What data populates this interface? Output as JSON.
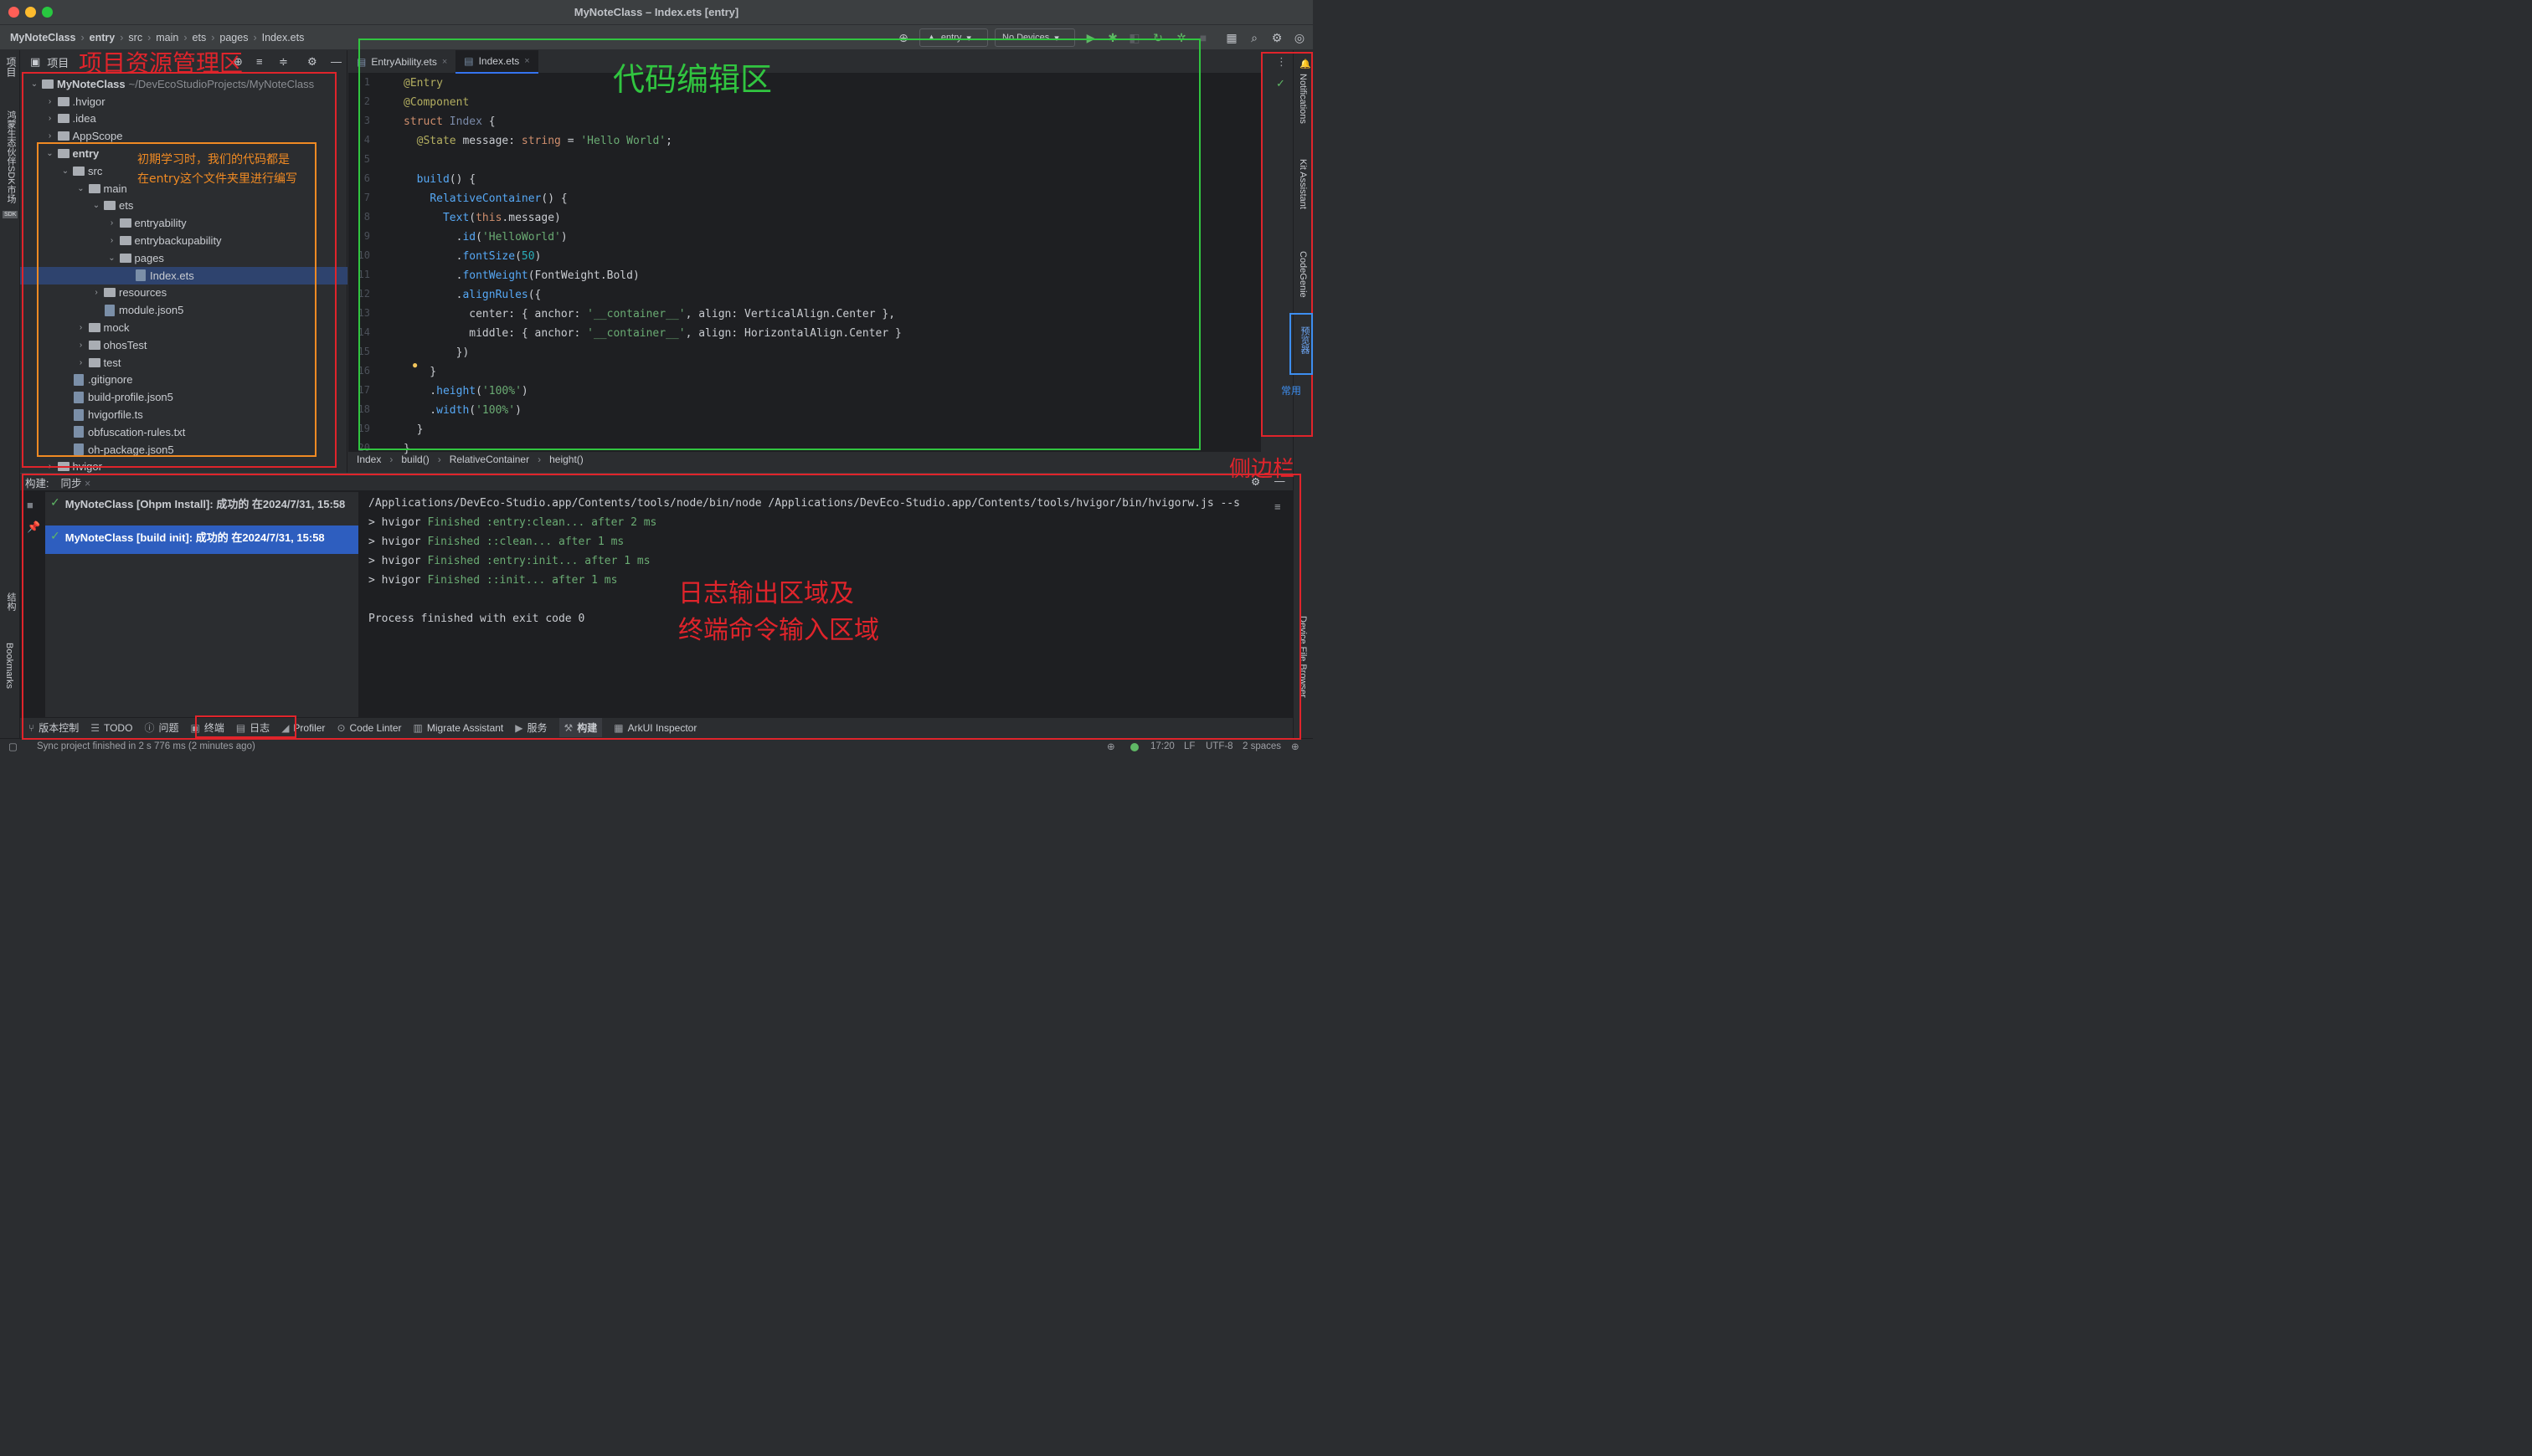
{
  "window": {
    "title": "MyNoteClass – Index.ets [entry]"
  },
  "breadcrumb": [
    "MyNoteClass",
    "entry",
    "src",
    "main",
    "ets",
    "pages",
    "Index.ets"
  ],
  "run_toolbar": {
    "module": "entry",
    "devices": "No Devices"
  },
  "left_strip": {
    "project": "项目",
    "sdk": "鸿蒙生态伙伴SDK市场",
    "sdk_badge": "SDK",
    "structure": "结构",
    "bookmarks": "Bookmarks"
  },
  "project_panel": {
    "title": "项目",
    "tree": [
      {
        "label": "MyNoteClass",
        "path": "~/DevEcoStudioProjects/MyNoteClass",
        "depth": 0,
        "arrow": "⌄",
        "kind": "folder"
      },
      {
        "label": ".hvigor",
        "depth": 1,
        "arrow": "›",
        "kind": "folder"
      },
      {
        "label": ".idea",
        "depth": 1,
        "arrow": "›",
        "kind": "folder"
      },
      {
        "label": "AppScope",
        "depth": 1,
        "arrow": "›",
        "kind": "folder"
      },
      {
        "label": "entry",
        "depth": 1,
        "arrow": "⌄",
        "kind": "folder"
      },
      {
        "label": "src",
        "depth": 2,
        "arrow": "⌄",
        "kind": "folder"
      },
      {
        "label": "main",
        "depth": 3,
        "arrow": "⌄",
        "kind": "folder"
      },
      {
        "label": "ets",
        "depth": 4,
        "arrow": "⌄",
        "kind": "folder"
      },
      {
        "label": "entryability",
        "depth": 5,
        "arrow": "›",
        "kind": "folder"
      },
      {
        "label": "entrybackupability",
        "depth": 5,
        "arrow": "›",
        "kind": "folder"
      },
      {
        "label": "pages",
        "depth": 5,
        "arrow": "⌄",
        "kind": "folder"
      },
      {
        "label": "Index.ets",
        "depth": 6,
        "arrow": "",
        "kind": "file",
        "selected": true
      },
      {
        "label": "resources",
        "depth": 4,
        "arrow": "›",
        "kind": "folder"
      },
      {
        "label": "module.json5",
        "depth": 4,
        "arrow": "",
        "kind": "file"
      },
      {
        "label": "mock",
        "depth": 3,
        "arrow": "›",
        "kind": "folder"
      },
      {
        "label": "ohosTest",
        "depth": 3,
        "arrow": "›",
        "kind": "folder"
      },
      {
        "label": "test",
        "depth": 3,
        "arrow": "›",
        "kind": "folder"
      },
      {
        "label": ".gitignore",
        "depth": 2,
        "arrow": "",
        "kind": "file"
      },
      {
        "label": "build-profile.json5",
        "depth": 2,
        "arrow": "",
        "kind": "file"
      },
      {
        "label": "hvigorfile.ts",
        "depth": 2,
        "arrow": "",
        "kind": "file"
      },
      {
        "label": "obfuscation-rules.txt",
        "depth": 2,
        "arrow": "",
        "kind": "file"
      },
      {
        "label": "oh-package.json5",
        "depth": 2,
        "arrow": "",
        "kind": "file"
      },
      {
        "label": "hvigor",
        "depth": 1,
        "arrow": "›",
        "kind": "folder"
      }
    ]
  },
  "editor": {
    "tabs": [
      {
        "label": "EntryAbility.ets",
        "active": false
      },
      {
        "label": "Index.ets",
        "active": true
      }
    ],
    "line_numbers": [
      "1",
      "2",
      "3",
      "4",
      "5",
      "6",
      "7",
      "8",
      "9",
      "10",
      "11",
      "12",
      "13",
      "14",
      "15",
      "16",
      "17",
      "18",
      "19",
      "20"
    ],
    "code": [
      [
        [
          "an",
          "@Entry"
        ]
      ],
      [
        [
          "an",
          "@Component"
        ]
      ],
      [
        [
          "kw",
          "struct "
        ],
        [
          "tp",
          "Index"
        ],
        [
          "ty",
          " {"
        ]
      ],
      [
        [
          "ty",
          "  "
        ],
        [
          "an",
          "@State "
        ],
        [
          "ty",
          "message: "
        ],
        [
          "kw",
          "string"
        ],
        [
          "ty",
          " = "
        ],
        [
          "str",
          "'Hello World'"
        ],
        [
          "ty",
          ";"
        ]
      ],
      [],
      [
        [
          "ty",
          "  "
        ],
        [
          "fn",
          "build"
        ],
        [
          "ty",
          "() {"
        ]
      ],
      [
        [
          "ty",
          "    "
        ],
        [
          "fn",
          "RelativeContainer"
        ],
        [
          "ty",
          "() {"
        ]
      ],
      [
        [
          "ty",
          "      "
        ],
        [
          "fn",
          "Text"
        ],
        [
          "ty",
          "("
        ],
        [
          "kw",
          "this"
        ],
        [
          "ty",
          ".message)"
        ]
      ],
      [
        [
          "ty",
          "        ."
        ],
        [
          "fn",
          "id"
        ],
        [
          "ty",
          "("
        ],
        [
          "str",
          "'HelloWorld'"
        ],
        [
          "ty",
          ")"
        ]
      ],
      [
        [
          "ty",
          "        ."
        ],
        [
          "fn",
          "fontSize"
        ],
        [
          "ty",
          "("
        ],
        [
          "num",
          "50"
        ],
        [
          "ty",
          ")"
        ]
      ],
      [
        [
          "ty",
          "        ."
        ],
        [
          "fn",
          "fontWeight"
        ],
        [
          "ty",
          "(FontWeight.Bold)"
        ]
      ],
      [
        [
          "ty",
          "        ."
        ],
        [
          "fn",
          "alignRules"
        ],
        [
          "ty",
          "({"
        ]
      ],
      [
        [
          "ty",
          "          center: { anchor: "
        ],
        [
          "str",
          "'__container__'"
        ],
        [
          "ty",
          ", align: VerticalAlign.Center },"
        ]
      ],
      [
        [
          "ty",
          "          middle: { anchor: "
        ],
        [
          "str",
          "'__container__'"
        ],
        [
          "ty",
          ", align: HorizontalAlign.Center }"
        ]
      ],
      [
        [
          "ty",
          "        })"
        ]
      ],
      [
        [
          "ty",
          "    }"
        ]
      ],
      [
        [
          "ty",
          "    ."
        ],
        [
          "fn",
          "height"
        ],
        [
          "ty",
          "("
        ],
        [
          "str",
          "'100%'"
        ],
        [
          "ty",
          ")"
        ]
      ],
      [
        [
          "ty",
          "    ."
        ],
        [
          "fn",
          "width"
        ],
        [
          "ty",
          "("
        ],
        [
          "str",
          "'100%'"
        ],
        [
          "ty",
          ")"
        ]
      ],
      [
        [
          "ty",
          "  }"
        ]
      ],
      [
        [
          "ty",
          "}"
        ]
      ]
    ],
    "status_path": [
      "Index",
      "build()",
      "RelativeContainer",
      "height()"
    ]
  },
  "right_strip": {
    "notifications": "Notifications",
    "kit": "Kit Assistant",
    "codegenie": "CodeGenie",
    "previewer": "预览器",
    "common": "常用",
    "device_file": "Device File Browser"
  },
  "build_panel": {
    "tab_build": "构建:",
    "tab_sync": "同步",
    "items": [
      {
        "text": "MyNoteClass [Ohpm Install]: 成功的 在2024/7/31, 15:58",
        "selected": false
      },
      {
        "text": "MyNoteClass [build init]: 成功的 在2024/7/31, 15:58",
        "selected": true
      }
    ],
    "console": [
      {
        "prefix": "/Applications/DevEco-Studio.app/Contents/tools/node/bin/node /Applications/DevEco-Studio.app/Contents/tools/hvigor/bin/hvigorw.js --s",
        "green": "",
        "suffix": ""
      },
      {
        "prefix": "> hvigor ",
        "green": "Finished :entry:clean... after 2 ms",
        "suffix": ""
      },
      {
        "prefix": "> hvigor ",
        "green": "Finished ::clean... after 1 ms",
        "suffix": ""
      },
      {
        "prefix": "> hvigor ",
        "green": "Finished :entry:init... after 1 ms",
        "suffix": ""
      },
      {
        "prefix": "> hvigor ",
        "green": "Finished ::init... after 1 ms",
        "suffix": ""
      },
      {
        "prefix": "",
        "green": "",
        "suffix": ""
      },
      {
        "prefix": "Process finished with exit code 0",
        "green": "",
        "suffix": ""
      }
    ]
  },
  "tool_windows": [
    "版本控制",
    "TODO",
    "问题",
    "终端",
    "日志",
    "Profiler",
    "Code Linter",
    "Migrate Assistant",
    "服务",
    "构建",
    "ArkUI Inspector"
  ],
  "status_bar": {
    "message": "Sync project finished in 2 s 776 ms (2 minutes ago)",
    "position": "17:20",
    "line_sep": "LF",
    "encoding": "UTF-8",
    "indent": "2 spaces"
  },
  "annotations": {
    "project_area": "项目资源管理区",
    "entry_note_1": "初期学习时，我们的代码都是",
    "entry_note_2": "在entry这个文件夹里进行编写",
    "editor_area": "代码编辑区",
    "sidebar": "侧边栏",
    "log_area_1": "日志输出区域及",
    "log_area_2": "终端命令输入区域"
  },
  "colors": {
    "red_annotation": "#e0242b",
    "green_annotation": "#31c540",
    "orange_annotation": "#f08a23",
    "accent": "#3574f0"
  }
}
